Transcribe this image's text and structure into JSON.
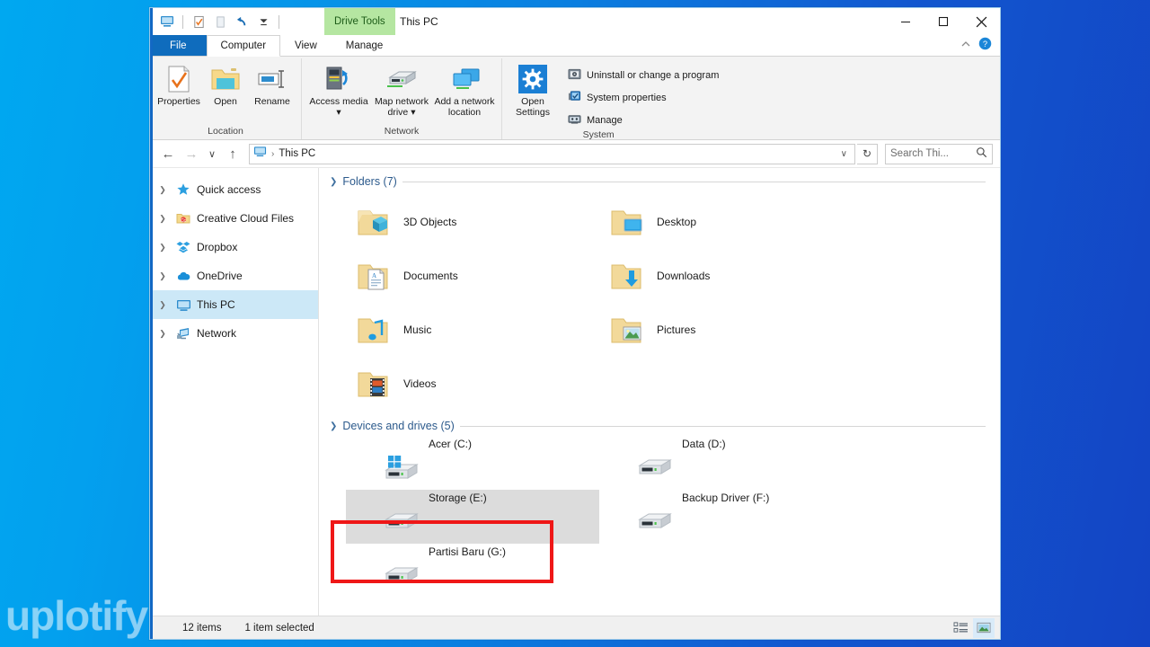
{
  "window": {
    "title": "This PC",
    "contextual_tab": "Drive Tools",
    "quick_access_icons": [
      "this-pc-icon",
      "properties-icon",
      "new-folder-icon",
      "undo-icon",
      "customize-caret-icon"
    ],
    "controls": {
      "minimize": "–",
      "maximize": "□",
      "close": "✕"
    },
    "ribbon_collapse": "∧",
    "help": "?"
  },
  "tabs": [
    {
      "label": "File",
      "type": "file"
    },
    {
      "label": "Computer",
      "type": "active"
    },
    {
      "label": "View",
      "type": "normal"
    },
    {
      "label": "Manage",
      "type": "contextual"
    }
  ],
  "ribbon": {
    "groups": [
      {
        "label": "Location",
        "buttons": [
          {
            "label": "Properties",
            "icon": "properties-page-icon"
          },
          {
            "label": "Open",
            "icon": "open-folder-icon"
          },
          {
            "label": "Rename",
            "icon": "rename-icon"
          }
        ]
      },
      {
        "label": "Network",
        "buttons": [
          {
            "label": "Access media",
            "icon": "access-media-icon",
            "dropdown": true
          },
          {
            "label": "Map network drive",
            "icon": "map-network-drive-icon",
            "dropdown": true
          },
          {
            "label": "Add a network location",
            "icon": "add-network-location-icon",
            "dropdown": false
          }
        ]
      },
      {
        "label": "System",
        "buttons": [
          {
            "label": "Open Settings",
            "icon": "gear-icon"
          }
        ],
        "list": [
          {
            "label": "Uninstall or change a program",
            "icon": "uninstall-icon"
          },
          {
            "label": "System properties",
            "icon": "system-properties-icon"
          },
          {
            "label": "Manage",
            "icon": "manage-icon"
          }
        ]
      }
    ]
  },
  "address": {
    "back": "←",
    "forward": "→",
    "recent": "∨",
    "up": "↑",
    "crumb_icon": "this-pc-icon",
    "crumb": "This PC",
    "separator": "›",
    "dropdown": "∨",
    "refresh": "↻",
    "search_placeholder": "Search Thi...",
    "search_value": ""
  },
  "sidebar": {
    "items": [
      {
        "label": "Quick access",
        "icon": "star-icon",
        "selected": false
      },
      {
        "label": "Creative Cloud Files",
        "icon": "creative-cloud-icon",
        "selected": false
      },
      {
        "label": "Dropbox",
        "icon": "dropbox-icon",
        "selected": false
      },
      {
        "label": "OneDrive",
        "icon": "onedrive-cloud-icon",
        "selected": false
      },
      {
        "label": "This PC",
        "icon": "this-pc-icon",
        "selected": true
      },
      {
        "label": "Network",
        "icon": "network-icon",
        "selected": false
      }
    ]
  },
  "content": {
    "folders_section": {
      "title": "Folders (7)",
      "items": [
        {
          "label": "3D Objects",
          "icon": "folder-3d-objects-icon"
        },
        {
          "label": "Desktop",
          "icon": "folder-desktop-icon"
        },
        {
          "label": "Documents",
          "icon": "folder-documents-icon"
        },
        {
          "label": "Downloads",
          "icon": "folder-downloads-icon"
        },
        {
          "label": "Music",
          "icon": "folder-music-icon"
        },
        {
          "label": "Pictures",
          "icon": "folder-pictures-icon"
        },
        {
          "label": "Videos",
          "icon": "folder-videos-icon"
        }
      ]
    },
    "drives_section": {
      "title": "Devices and drives (5)",
      "items": [
        {
          "label": "Acer (C:)",
          "icon": "windows-drive-icon",
          "selected": false
        },
        {
          "label": "Data (D:)",
          "icon": "drive-icon",
          "selected": false
        },
        {
          "label": "Storage (E:)",
          "icon": "drive-icon",
          "selected": true
        },
        {
          "label": "Backup Driver (F:)",
          "icon": "drive-icon",
          "selected": false
        },
        {
          "label": "Partisi Baru (G:)",
          "icon": "drive-icon",
          "selected": false
        }
      ]
    }
  },
  "status": {
    "item_count": "12 items",
    "selection": "1 item selected",
    "views": [
      {
        "name": "details-view",
        "active": false
      },
      {
        "name": "large-icons-view",
        "active": true
      }
    ]
  },
  "watermark": {
    "text": "uplotify"
  },
  "colors": {
    "accent": "#0f6cbd",
    "contextual_tab": "#b5e6a1",
    "highlight_box": "#ef1717",
    "selection": "#cce8f7",
    "desktop_left": "#00a8f0",
    "desktop_right": "#1344c4"
  }
}
